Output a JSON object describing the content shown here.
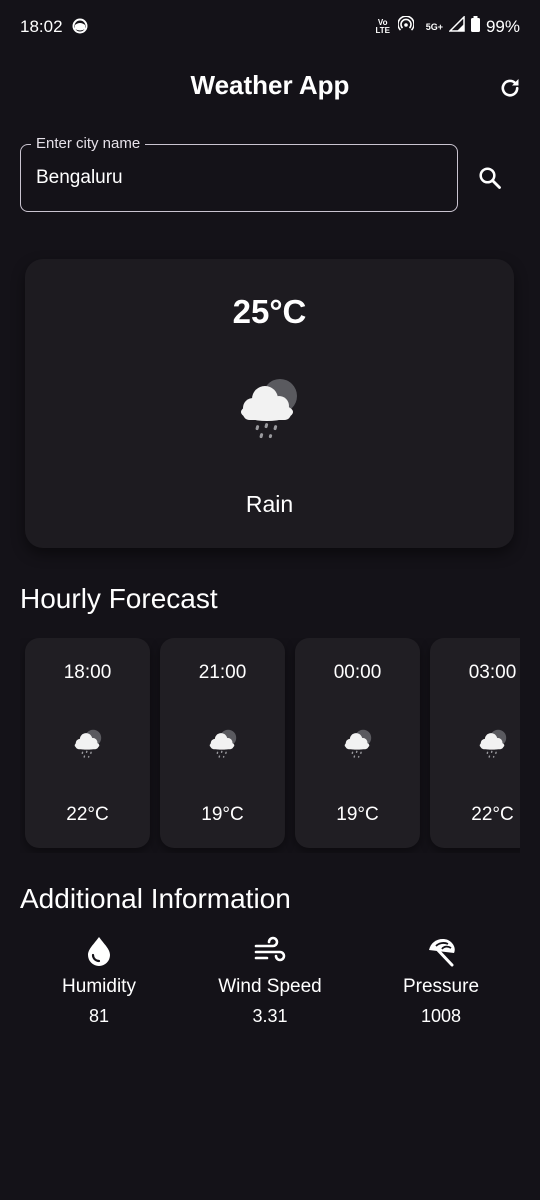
{
  "status_bar": {
    "time": "18:02",
    "volte_top": "Vo",
    "volte_bottom": "LTE",
    "network": "5G+",
    "battery": "99%"
  },
  "app_bar": {
    "title": "Weather App",
    "refresh_icon": "refresh-icon"
  },
  "search": {
    "label": "Enter city name",
    "value": "Bengaluru",
    "icon": "search-icon"
  },
  "current": {
    "temperature": "25°C",
    "condition": "Rain",
    "icon": "rain-cloud-icon"
  },
  "hourly": {
    "title": "Hourly Forecast",
    "items": [
      {
        "time": "18:00",
        "temp": "22°C",
        "icon": "rain-cloud-icon"
      },
      {
        "time": "21:00",
        "temp": "19°C",
        "icon": "rain-cloud-icon"
      },
      {
        "time": "00:00",
        "temp": "19°C",
        "icon": "rain-cloud-icon"
      },
      {
        "time": "03:00",
        "temp": "22°C",
        "icon": "rain-cloud-icon"
      }
    ]
  },
  "additional": {
    "title": "Additional Information",
    "items": [
      {
        "label": "Humidity",
        "value": "81",
        "icon": "water-drop-icon"
      },
      {
        "label": "Wind Speed",
        "value": "3.31",
        "icon": "air-icon"
      },
      {
        "label": "Pressure",
        "value": "1008",
        "icon": "beach-access-icon"
      }
    ]
  },
  "colors": {
    "background": "#141218",
    "card": "#1d1b20",
    "text": "#ffffff",
    "outline": "#cac4d0"
  }
}
